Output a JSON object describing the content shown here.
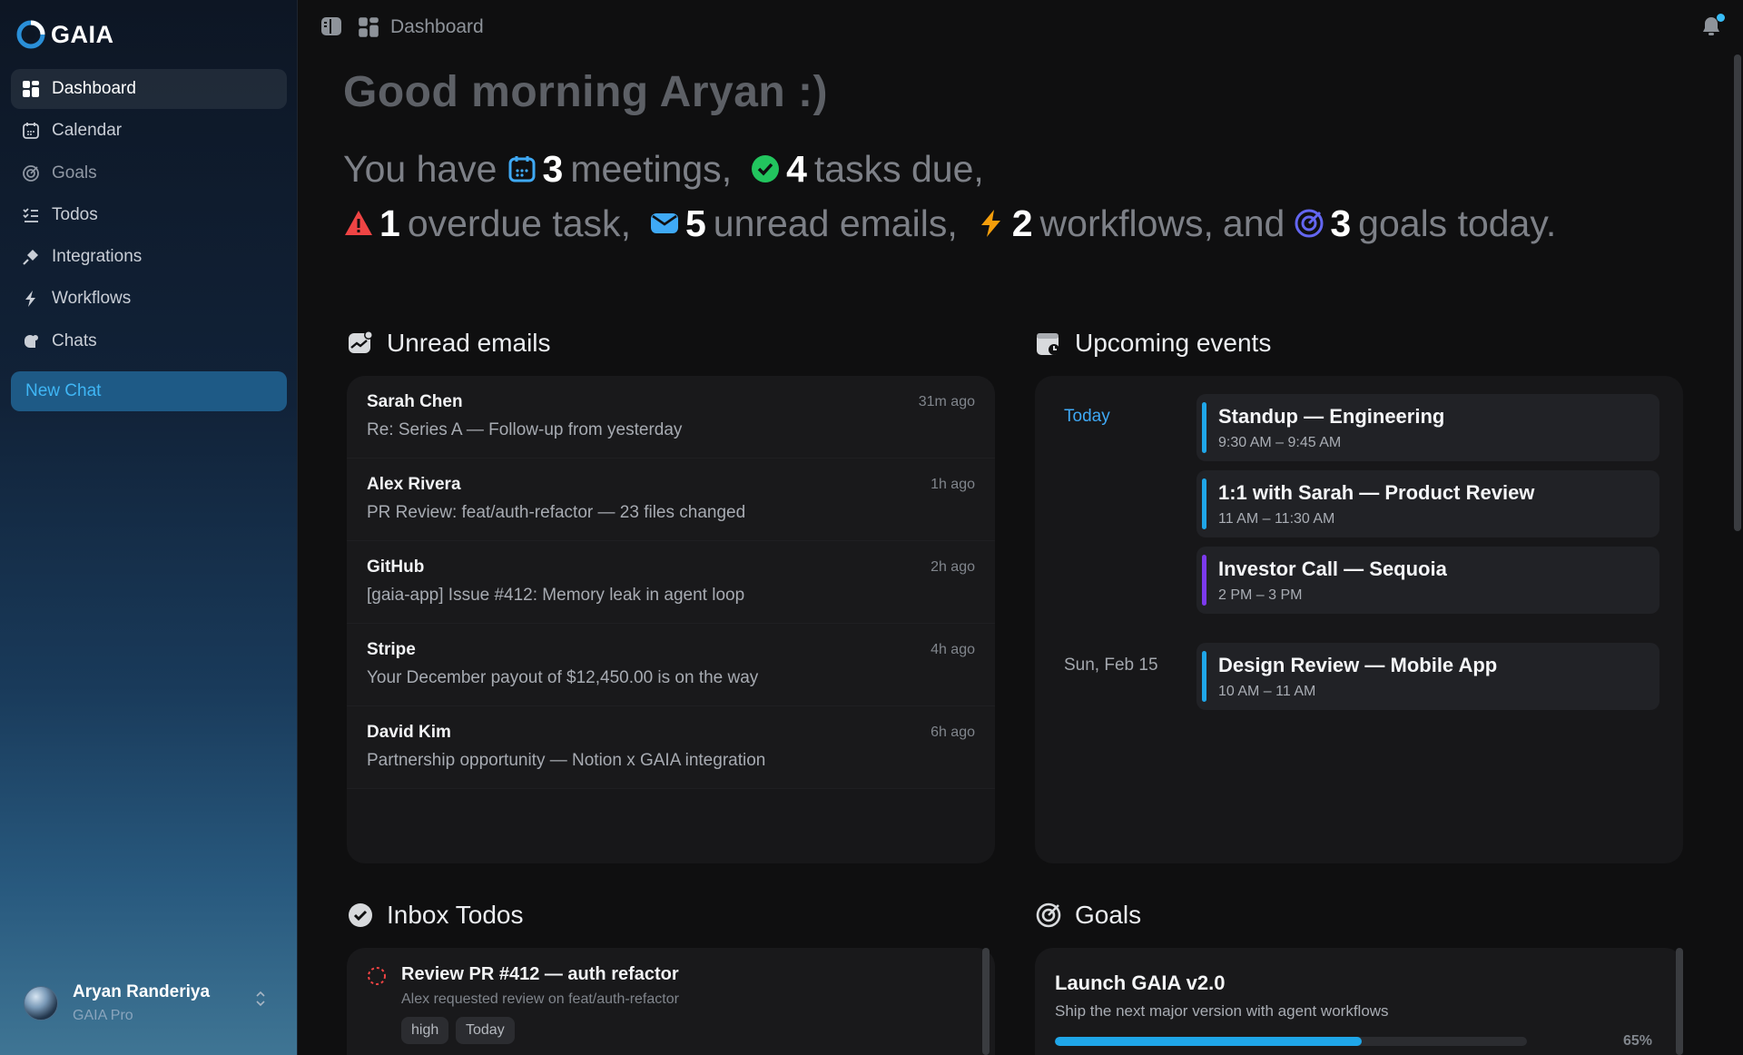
{
  "app": {
    "name": "GAIA",
    "brand_color": "#2a8fd8"
  },
  "sidebar": {
    "items": [
      {
        "label": "Dashboard",
        "icon": "dashboard-icon",
        "active": true
      },
      {
        "label": "Calendar",
        "icon": "calendar-icon"
      },
      {
        "label": "Goals",
        "icon": "target-icon"
      },
      {
        "label": "Todos",
        "icon": "checklist-icon"
      },
      {
        "label": "Integrations",
        "icon": "plug-icon"
      },
      {
        "label": "Workflows",
        "icon": "bolt-icon"
      },
      {
        "label": "Chats",
        "icon": "chat-bubbles-icon"
      }
    ],
    "new_chat_label": "New Chat",
    "user": {
      "name": "Aryan Randeriya",
      "plan": "GAIA Pro"
    }
  },
  "header": {
    "title": "Dashboard"
  },
  "greeting": {
    "text": "Good morning Aryan :)",
    "prefix": "You have",
    "meetings_count": "3",
    "meetings_label": "meetings",
    "tasks_due_count": "4",
    "tasks_due_label": "tasks due",
    "overdue_count": "1",
    "overdue_label": "overdue task",
    "emails_count": "5",
    "emails_label": "unread emails",
    "workflows_count": "2",
    "workflows_label": "workflows",
    "and_label": "and",
    "goals_count": "3",
    "goals_label": "goals today.",
    "comma": ","
  },
  "emails": {
    "title": "Unread emails",
    "items": [
      {
        "from": "Sarah Chen",
        "subject": "Re: Series A — Follow-up from yesterday",
        "time": "31m ago"
      },
      {
        "from": "Alex Rivera",
        "subject": "PR Review: feat/auth-refactor — 23 files changed",
        "time": "1h ago"
      },
      {
        "from": "GitHub",
        "subject": "[gaia-app] Issue #412: Memory leak in agent loop",
        "time": "2h ago"
      },
      {
        "from": "Stripe",
        "subject": "Your December payout of $12,450.00 is on the way",
        "time": "4h ago"
      },
      {
        "from": "David Kim",
        "subject": "Partnership opportunity — Notion x GAIA integration",
        "time": "6h ago"
      }
    ]
  },
  "events": {
    "title": "Upcoming events",
    "days": [
      {
        "label": "Today",
        "items": [
          {
            "title": "Standup — Engineering",
            "time": "9:30 AM – 9:45 AM",
            "color": "#1fa6e8"
          },
          {
            "title": "1:1 with Sarah — Product Review",
            "time": "11 AM – 11:30 AM",
            "color": "#1fa6e8"
          },
          {
            "title": "Investor Call — Sequoia",
            "time": "2 PM – 3 PM",
            "color": "#7c3aed"
          }
        ]
      },
      {
        "label": "Sun, Feb 15",
        "items": [
          {
            "title": "Design Review — Mobile App",
            "time": "10 AM – 11 AM",
            "color": "#1fa6e8"
          }
        ]
      }
    ]
  },
  "todos": {
    "title": "Inbox Todos",
    "items": [
      {
        "title": "Review PR #412 — auth refactor",
        "description": "Alex requested review on feat/auth-refactor",
        "tags": [
          "high",
          "Today"
        ]
      }
    ]
  },
  "goals": {
    "title": "Goals",
    "items": [
      {
        "title": "Launch GAIA v2.0",
        "description": "Ship the next major version with agent workflows",
        "progress_label": "65%",
        "progress": 0.65
      }
    ]
  }
}
